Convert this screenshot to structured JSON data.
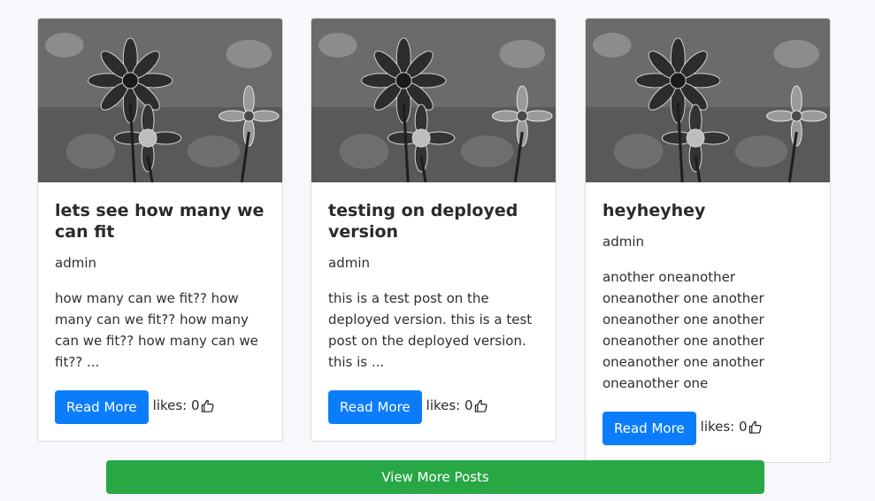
{
  "posts": [
    {
      "title": "lets see how many we can fit",
      "author": "admin",
      "excerpt": "how many can we fit?? how many can we fit?? how many can we fit?? how many can we fit?? ...",
      "read_more_label": "Read More",
      "likes_label": "likes: 0",
      "image_icon": "flower-photo"
    },
    {
      "title": "testing on deployed version",
      "author": "admin",
      "excerpt": "this is a test post on the deployed version. this is a test post on the deployed version. this is ...",
      "read_more_label": "Read More",
      "likes_label": "likes: 0",
      "image_icon": "flower-photo"
    },
    {
      "title": "heyheyhey",
      "author": "admin",
      "excerpt": "another oneanother oneanother one another oneanother one another oneanother one another oneanother one another oneanother one",
      "read_more_label": "Read More",
      "likes_label": "likes: 0",
      "image_icon": "flower-photo"
    }
  ],
  "view_more_label": "View More Posts",
  "colors": {
    "primary": "#0b7dfb",
    "success": "#28a745",
    "background": "#f8f8fc"
  }
}
